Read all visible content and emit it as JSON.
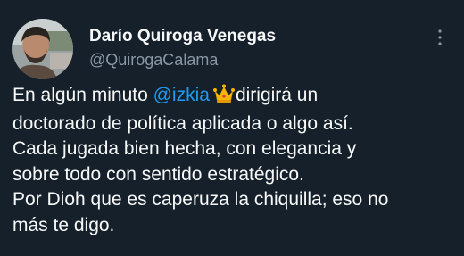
{
  "author": {
    "name": "Darío Quiroga Venegas",
    "handle": "@QuirogaCalama"
  },
  "tweet": {
    "line1_before": "En algún minuto ",
    "mention": "@izkia",
    "crown_icon": "crown-emoji",
    "line1_after": "dirigirá un",
    "line2": "doctorado de política aplicada o algo así.",
    "line3": "Cada jugada bien hecha, con elegancia y",
    "line4": "sobre todo con sentido estratégico.",
    "line5": "Por Dioh que es caperuza la chiquilla; eso no",
    "line6": "más te digo."
  },
  "colors": {
    "background": "#15202b",
    "text": "#f7f9f9",
    "muted": "#8b98a5",
    "link": "#1d9bf0",
    "crown": "#f5b400"
  }
}
